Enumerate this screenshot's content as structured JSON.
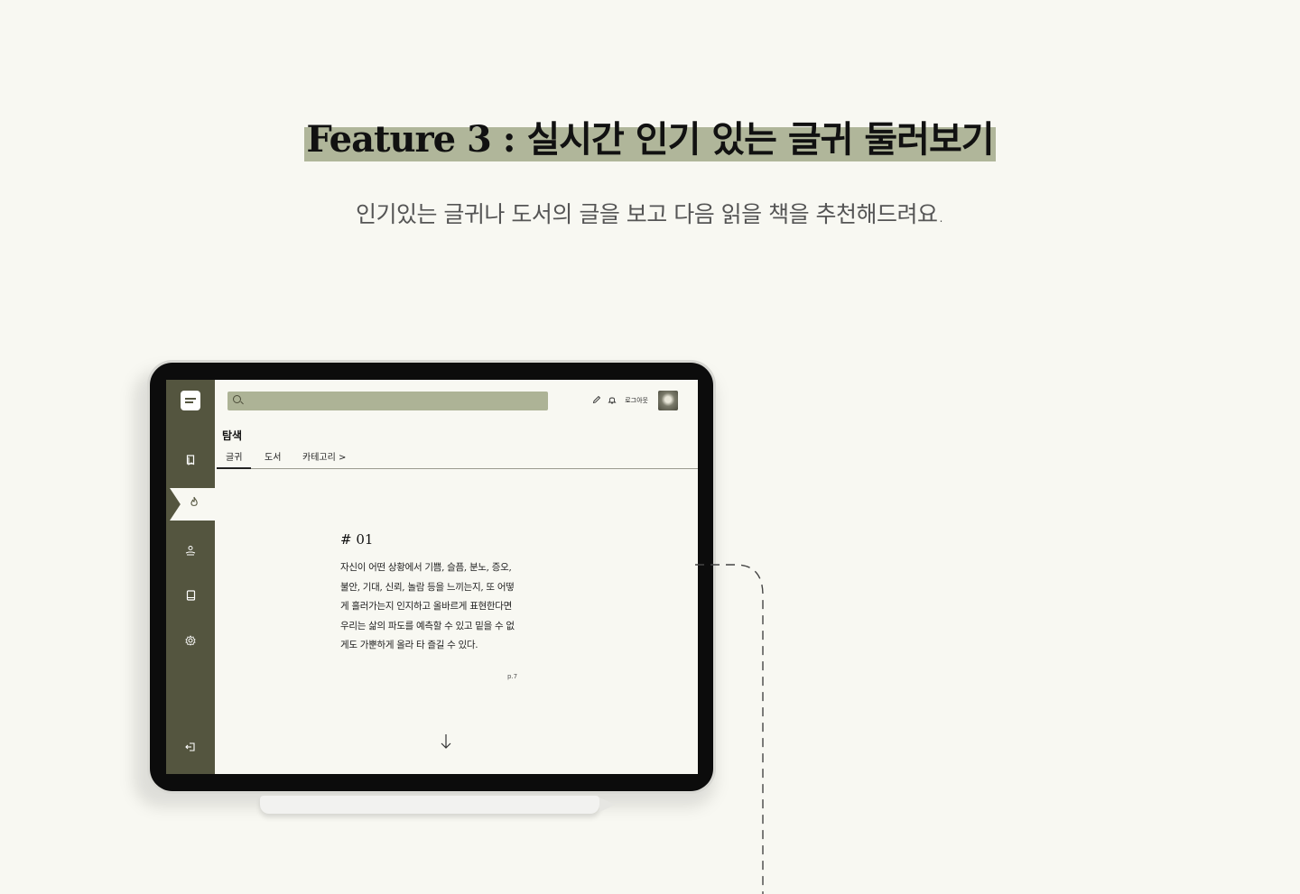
{
  "heading": {
    "title": "Feature 3 : 실시간 인기 있는 글귀 둘러보기",
    "subtitle": "인기있는 글귀나 도서의 글을 보고 다음 읽을 책을 추천해드려요."
  },
  "app": {
    "sidebar": {
      "items": [
        {
          "name": "library",
          "icon": "bookmark-icon"
        },
        {
          "name": "popular",
          "icon": "flame-icon",
          "active": true
        },
        {
          "name": "community",
          "icon": "user-hand-icon"
        },
        {
          "name": "books",
          "icon": "book-icon"
        },
        {
          "name": "settings",
          "icon": "gear-icon"
        }
      ],
      "logout_icon": "logout-icon"
    },
    "topbar": {
      "search_placeholder": "",
      "logout_label": "로그아웃"
    },
    "page_title": "탐색",
    "tabs": [
      {
        "label": "글귀",
        "active": true
      },
      {
        "label": "도서",
        "active": false
      },
      {
        "label": "카테고리 >",
        "active": false
      }
    ],
    "quote": {
      "number": "# 01",
      "lines": [
        "자신이 어떤 상황에서 기쁨, 슬픔, 분노, 증오,",
        "불안, 기대, 신뢰, 놀람 등을 느끼는지, 또 어떻",
        "게 흘러가는지 인지하고 올바르게 표현한다면",
        "우리는 삶의 파도를 예측할 수 있고 밑을 수 없",
        "게도 가뿐하게 올라 타 즐길 수 있다."
      ],
      "page": "p.7"
    }
  },
  "colors": {
    "background": "#f8f8f2",
    "sidebar": "#54553f",
    "accent": "#adb396"
  }
}
